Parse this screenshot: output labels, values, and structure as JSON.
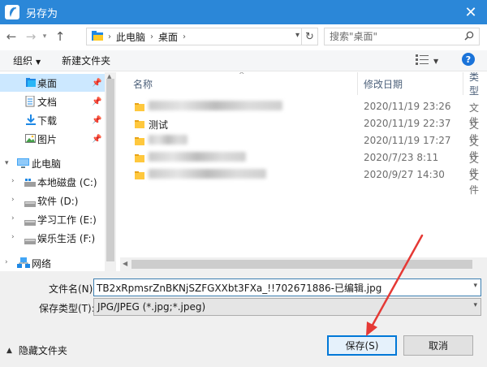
{
  "window": {
    "title": "另存为"
  },
  "address": {
    "crumbs": [
      "此电脑",
      "桌面"
    ],
    "search_placeholder": "搜索\"桌面\""
  },
  "toolbar": {
    "organize": "组织",
    "new_folder": "新建文件夹"
  },
  "nav": {
    "items": [
      {
        "label": "桌面",
        "icon": "desktop-folder-icon",
        "pinned": true,
        "selected": true
      },
      {
        "label": "文档",
        "icon": "documents-icon",
        "pinned": true
      },
      {
        "label": "下载",
        "icon": "download-icon",
        "pinned": true
      },
      {
        "label": "图片",
        "icon": "pictures-icon",
        "pinned": true
      },
      {
        "label": "此电脑",
        "icon": "computer-icon",
        "expanded": true
      },
      {
        "label": "本地磁盘 (C:)",
        "icon": "drive-icon"
      },
      {
        "label": "软件 (D:)",
        "icon": "drive-icon"
      },
      {
        "label": "学习工作 (E:)",
        "icon": "drive-icon"
      },
      {
        "label": "娱乐生活 (F:)",
        "icon": "drive-icon"
      },
      {
        "label": "网络",
        "icon": "network-icon"
      }
    ]
  },
  "files": {
    "columns": {
      "name": "名称",
      "date": "修改日期",
      "type": "类型"
    },
    "rows": [
      {
        "name": "",
        "name_blurred": true,
        "date": "2020/11/19 23:26",
        "type": "文件"
      },
      {
        "name": "测试",
        "name_blurred": false,
        "date": "2020/11/19 22:37",
        "type": "文件"
      },
      {
        "name": "",
        "name_blurred": true,
        "date": "2020/11/19 17:27",
        "type": "文件"
      },
      {
        "name": "",
        "name_blurred": true,
        "date": "2020/7/23 8:11",
        "type": "文件"
      },
      {
        "name": "",
        "name_blurred": true,
        "date": "2020/9/27 14:30",
        "type": "文件"
      }
    ]
  },
  "form": {
    "filename_label": "文件名(N):",
    "filename_value": "TB2xRpmsrZnBKNjSZFGXXbt3FXa_!!702671886-已编辑.jpg",
    "type_label": "保存类型(T):",
    "type_value": "JPG/JPEG (*.jpg;*.jpeg)"
  },
  "footer": {
    "hide_folders": "隐藏文件夹",
    "save": "保存(S)",
    "cancel": "取消"
  },
  "colors": {
    "titlebar": "#2b87d8",
    "selection": "#cce8ff",
    "accent": "#0078d7",
    "annotation_arrow": "#e53935"
  }
}
